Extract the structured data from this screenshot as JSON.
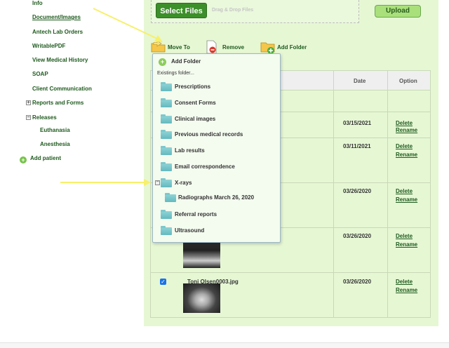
{
  "sidebar": {
    "items": [
      {
        "label": "Info"
      },
      {
        "label": "Document/Images"
      },
      {
        "label": "Antech Lab Orders"
      },
      {
        "label": "WritablePDF"
      },
      {
        "label": "View Medical History"
      },
      {
        "label": "SOAP"
      },
      {
        "label": "Client Communication"
      },
      {
        "label": "Reports and Forms"
      },
      {
        "label": "Releases"
      },
      {
        "label": "Euthanasia"
      },
      {
        "label": "Anesthesia"
      },
      {
        "label": "Add patient"
      }
    ]
  },
  "upload": {
    "select_files": "Select Files",
    "drag_drop": "Drag & Drop Files",
    "upload": "Upload"
  },
  "toolbar": {
    "move_to": "Move To",
    "remove": "Remove",
    "add_folder": "Add Folder"
  },
  "table": {
    "headers": {
      "date": "Date",
      "option": "Option"
    },
    "rows": [
      {
        "date": "03/15/2021",
        "delete": "Delete",
        "rename": "Rename"
      },
      {
        "date": "03/11/2021",
        "delete": "Delete",
        "rename": "Rename"
      },
      {
        "date": "03/26/2020",
        "delete": "Delete",
        "rename": "Rename"
      },
      {
        "date": "03/26/2020",
        "delete": "Delete",
        "rename": "Rename"
      },
      {
        "date": "03/26/2020",
        "delete": "Delete",
        "rename": "Rename",
        "file": "Toni Olsen0003.jpg",
        "checked": true
      }
    ]
  },
  "dropdown": {
    "add_folder": "Add Folder",
    "existing": "Existings folder...",
    "folders": [
      "Prescriptions",
      "Consent Forms",
      "Clinical images",
      "Previous medical records",
      "Lab results",
      "Email correspondence",
      "X-rays",
      "Referral reports",
      "Ultrasound"
    ],
    "subfolder": "Radiographs March 26, 2020"
  },
  "colors": {
    "panel": "#e6f7d4",
    "brand_green": "#3c8f2a",
    "arrow_yellow": "#f7f06a"
  }
}
